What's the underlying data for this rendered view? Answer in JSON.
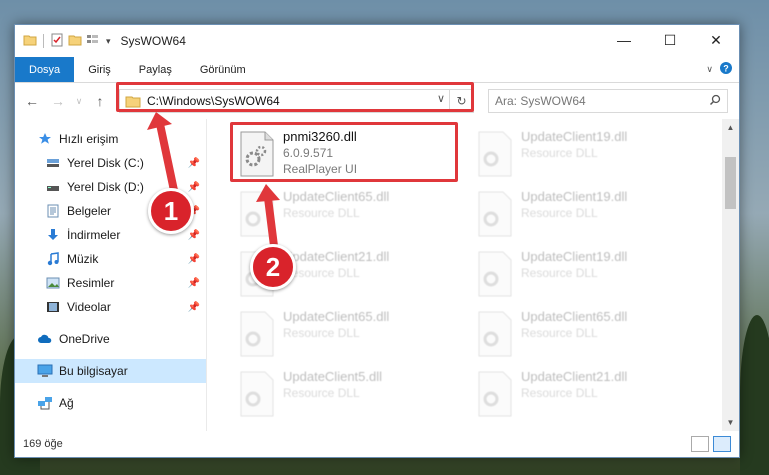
{
  "window": {
    "title": "SysWOW64",
    "controls": {
      "minimize": "—",
      "maximize": "☐",
      "close": "✕"
    }
  },
  "ribbon": {
    "tabs": [
      {
        "label": "Dosya"
      },
      {
        "label": "Giriş"
      },
      {
        "label": "Paylaş"
      },
      {
        "label": "Görünüm"
      }
    ]
  },
  "address": {
    "path": "C:\\Windows\\SysWOW64"
  },
  "search": {
    "placeholder": "Ara: SysWOW64"
  },
  "sidebar": {
    "quick_access": "Hızlı erişim",
    "items": [
      {
        "label": "Yerel Disk (C:)"
      },
      {
        "label": "Yerel Disk (D:)"
      },
      {
        "label": "Belgeler"
      },
      {
        "label": "İndirmeler"
      },
      {
        "label": "Müzik"
      },
      {
        "label": "Resimler"
      },
      {
        "label": "Videolar"
      }
    ],
    "onedrive": "OneDrive",
    "this_pc": "Bu bilgisayar",
    "network": "Ağ"
  },
  "files": [
    {
      "name": "pnmi3260.dll",
      "line2": "6.0.9.571",
      "line3": "RealPlayer UI"
    },
    {
      "name": "UpdateClient19.dll",
      "line2": "Resource DLL"
    },
    {
      "name": "UpdateClient65.dll",
      "line2": "Resource DLL"
    },
    {
      "name": "UpdateClient19.dll",
      "line2": "Resource DLL"
    },
    {
      "name": "UpdateClient21.dll",
      "line2": "Resource DLL"
    },
    {
      "name": "UpdateClient19.dll",
      "line2": "Resource DLL"
    },
    {
      "name": "UpdateClient65.dll",
      "line2": "Resource DLL"
    },
    {
      "name": "UpdateClient65.dll",
      "line2": "Resource DLL"
    },
    {
      "name": "UpdateClient5.dll",
      "line2": "Resource DLL"
    },
    {
      "name": "UpdateClient21.dll",
      "line2": "Resource DLL"
    }
  ],
  "status": {
    "count": "169 öğe"
  },
  "callouts": {
    "one": "1",
    "two": "2"
  },
  "colors": {
    "accent": "#1979ca",
    "highlight": "#e0373b",
    "callout": "#d9232b",
    "selected": "#cce8ff"
  }
}
